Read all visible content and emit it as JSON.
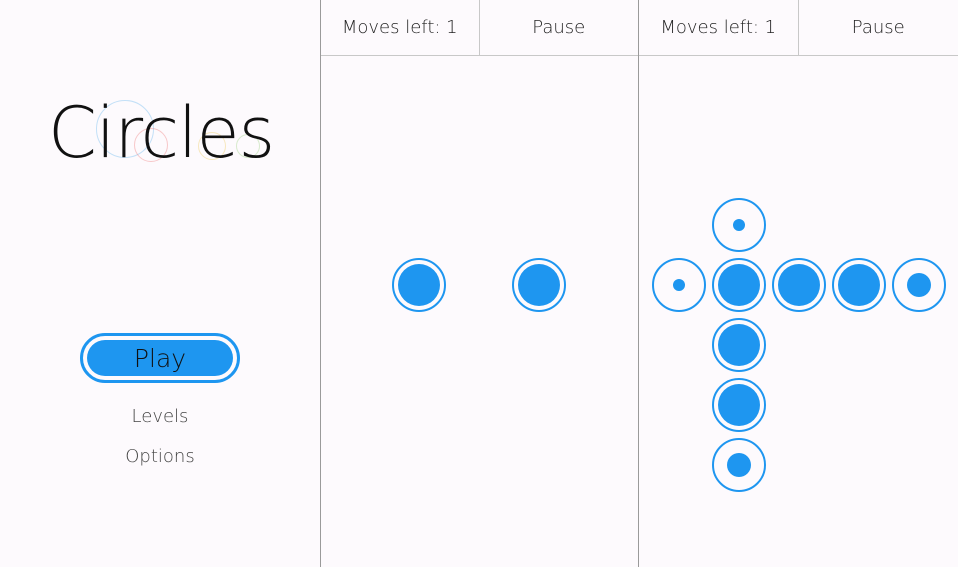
{
  "menu": {
    "title": "Circles",
    "play_label": "Play",
    "levels_label": "Levels",
    "options_label": "Options",
    "accent_color": "#1e96f0"
  },
  "games": [
    {
      "moves_label": "Moves left: 1",
      "pause_label": "Pause",
      "cells": [
        {
          "col": 0,
          "row": 0,
          "fill": "large"
        },
        {
          "col": 2,
          "row": 0,
          "fill": "large"
        }
      ]
    },
    {
      "moves_label": "Moves left: 1",
      "pause_label": "Pause",
      "cells": [
        {
          "col": 1,
          "row": -1,
          "fill": "small"
        },
        {
          "col": 0,
          "row": 0,
          "fill": "small"
        },
        {
          "col": 1,
          "row": 0,
          "fill": "large"
        },
        {
          "col": 2,
          "row": 0,
          "fill": "large"
        },
        {
          "col": 3,
          "row": 0,
          "fill": "large"
        },
        {
          "col": 4,
          "row": 0,
          "fill": "medium"
        },
        {
          "col": 1,
          "row": 1,
          "fill": "large"
        },
        {
          "col": 1,
          "row": 2,
          "fill": "large"
        },
        {
          "col": 1,
          "row": 3,
          "fill": "medium"
        }
      ]
    }
  ]
}
